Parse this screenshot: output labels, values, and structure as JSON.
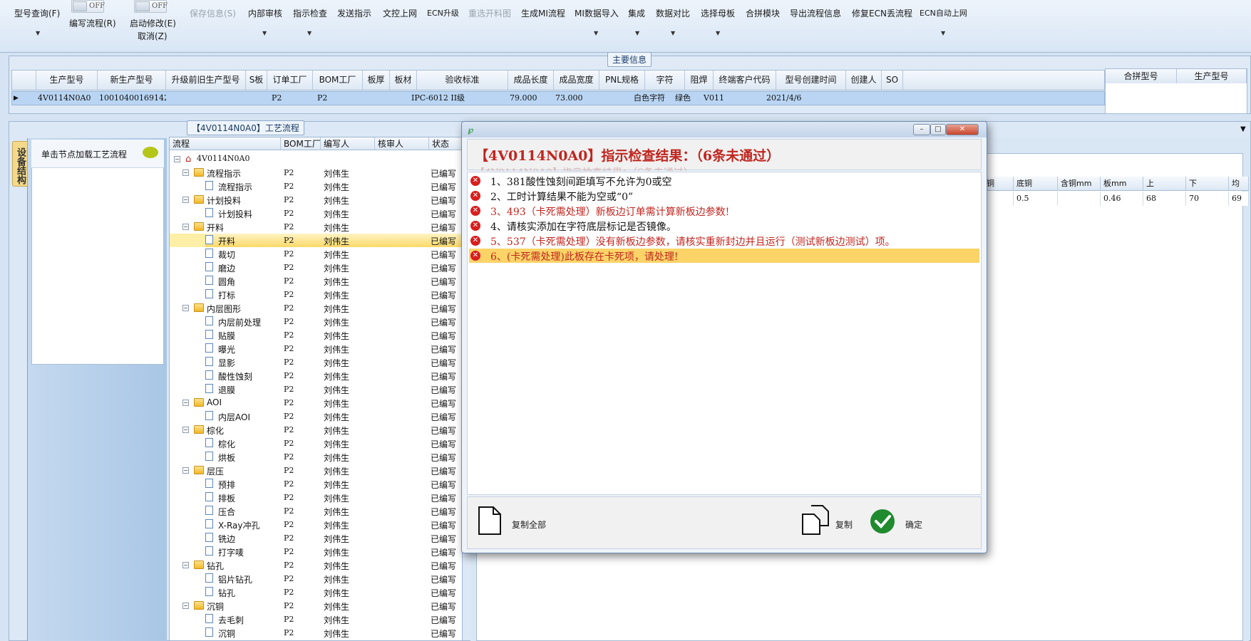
{
  "toolbar": {
    "items": [
      {
        "label": "型号查询(F)"
      },
      {
        "label": "编写流程(R)"
      },
      {
        "label": "启动修改(E)"
      },
      {
        "label": "取消(Z)"
      },
      {
        "label": "保存信息(S)"
      },
      {
        "label": "内部审核"
      },
      {
        "label": "指示检查"
      },
      {
        "label": "发送指示"
      },
      {
        "label": "文控上网"
      },
      {
        "label": "ECN升级"
      },
      {
        "label": "重选开料图"
      },
      {
        "label": "生成MI流程"
      },
      {
        "label": "MI数据导入"
      },
      {
        "label": "集成"
      },
      {
        "label": "数据对比"
      },
      {
        "label": "选择母板"
      },
      {
        "label": "合拼模块"
      },
      {
        "label": "导出流程信息"
      },
      {
        "label": "修复ECN丢流程"
      },
      {
        "label": "ECN自动上网"
      }
    ],
    "toggle1": "OFF",
    "toggle2": "OFF"
  },
  "main_info": {
    "title": "主要信息",
    "columns": [
      "生产型号",
      "新生产型号",
      "升级前旧生产型号",
      "S板",
      "订单工厂",
      "BOM工厂",
      "板厚",
      "板材",
      "验收标准",
      "成品长度",
      "成品宽度",
      "PNL规格",
      "字符",
      "阻焊",
      "终端客户代码",
      "型号创建时间",
      "创建人",
      "SO"
    ],
    "row": [
      "4V0114N0A0",
      "10010400169142",
      "",
      "",
      "P2",
      "P2",
      "",
      "",
      "IPC-6012 II级",
      "79.000",
      "73.000",
      "",
      "白色字符",
      "绿色",
      "V011",
      "2021/4/6",
      "",
      ""
    ],
    "right_columns": [
      "合拼型号",
      "生产型号"
    ]
  },
  "process": {
    "title": "【4V0114N0A0】工艺流程",
    "side_tab": "设备结构",
    "hint": "单击节点加载工艺流程",
    "columns": [
      "流程",
      "BOM工厂",
      "编写人",
      "核审人",
      "状态"
    ],
    "root": "4V0114N0A0",
    "rows": [
      {
        "name": "流程指示",
        "bom": "P2",
        "writer": "刘伟生",
        "status": "已编写"
      },
      {
        "name": "流程指示",
        "bom": "P2",
        "writer": "刘伟生",
        "status": "已编写"
      },
      {
        "name": "计划投料",
        "bom": "P2",
        "writer": "刘伟生",
        "status": "已编写"
      },
      {
        "name": "计划投料",
        "bom": "P2",
        "writer": "刘伟生",
        "status": "已编写"
      },
      {
        "name": "开料",
        "bom": "P2",
        "writer": "刘伟生",
        "status": "已编写"
      },
      {
        "name": "开料",
        "bom": "P2",
        "writer": "刘伟生",
        "status": "已编写"
      },
      {
        "name": "裁切",
        "bom": "P2",
        "writer": "刘伟生",
        "status": "已编写"
      },
      {
        "name": "磨边",
        "bom": "P2",
        "writer": "刘伟生",
        "status": "已编写"
      },
      {
        "name": "圆角",
        "bom": "P2",
        "writer": "刘伟生",
        "status": "已编写"
      },
      {
        "name": "打标",
        "bom": "P2",
        "writer": "刘伟生",
        "status": "已编写"
      },
      {
        "name": "内层图形",
        "bom": "P2",
        "writer": "刘伟生",
        "status": "已编写"
      },
      {
        "name": "内层前处理",
        "bom": "P2",
        "writer": "刘伟生",
        "status": "已编写"
      },
      {
        "name": "贴膜",
        "bom": "P2",
        "writer": "刘伟生",
        "status": "已编写"
      },
      {
        "name": "曝光",
        "bom": "P2",
        "writer": "刘伟生",
        "status": "已编写"
      },
      {
        "name": "显影",
        "bom": "P2",
        "writer": "刘伟生",
        "status": "已编写"
      },
      {
        "name": "酸性蚀刻",
        "bom": "P2",
        "writer": "刘伟生",
        "status": "已编写"
      },
      {
        "name": "退膜",
        "bom": "P2",
        "writer": "刘伟生",
        "status": "已编写"
      },
      {
        "name": "AOI",
        "bom": "P2",
        "writer": "刘伟生",
        "status": "已编写"
      },
      {
        "name": "内层AOI",
        "bom": "P2",
        "writer": "刘伟生",
        "status": "已编写"
      },
      {
        "name": "棕化",
        "bom": "P2",
        "writer": "刘伟生",
        "status": "已编写"
      },
      {
        "name": "棕化",
        "bom": "P2",
        "writer": "刘伟生",
        "status": "已编写"
      },
      {
        "name": "烘板",
        "bom": "P2",
        "writer": "刘伟生",
        "status": "已编写"
      },
      {
        "name": "层压",
        "bom": "P2",
        "writer": "刘伟生",
        "status": "已编写"
      },
      {
        "name": "预排",
        "bom": "P2",
        "writer": "刘伟生",
        "status": "已编写"
      },
      {
        "name": "排板",
        "bom": "P2",
        "writer": "刘伟生",
        "status": "已编写"
      },
      {
        "name": "压合",
        "bom": "P2",
        "writer": "刘伟生",
        "status": "已编写"
      },
      {
        "name": "X-Ray冲孔",
        "bom": "P2",
        "writer": "刘伟生",
        "status": "已编写"
      },
      {
        "name": "铣边",
        "bom": "P2",
        "writer": "刘伟生",
        "status": "已编写"
      },
      {
        "name": "打字唛",
        "bom": "P2",
        "writer": "刘伟生",
        "status": "已编写"
      },
      {
        "name": "钻孔",
        "bom": "P2",
        "writer": "刘伟生",
        "status": "已编写"
      },
      {
        "name": "铝片钻孔",
        "bom": "P2",
        "writer": "刘伟生",
        "status": "已编写"
      },
      {
        "name": "钻孔",
        "bom": "P2",
        "writer": "刘伟生",
        "status": "已编写"
      },
      {
        "name": "沉铜",
        "bom": "P2",
        "writer": "刘伟生",
        "status": "已编写"
      },
      {
        "name": "去毛刺",
        "bom": "P2",
        "writer": "刘伟生",
        "status": "已编写"
      },
      {
        "name": "沉铜",
        "bom": "P2",
        "writer": "刘伟生",
        "status": "已编写"
      }
    ]
  },
  "right_table": {
    "columns": [
      "铜",
      "底铜",
      "含铜mm",
      "板mm",
      "上",
      "下",
      "均"
    ],
    "row": [
      "",
      "0.5",
      "",
      "0.46",
      "68",
      "70",
      "69"
    ]
  },
  "dialog": {
    "title": "【4V0114N0A0】指示检查结果：（6条未通过）",
    "ghost": "【4V0114N0A0】指示检查结果：（6条未通过）",
    "items": [
      {
        "text": "1、381酸性蚀刻间距填写不允许为0或空",
        "color": "#111111"
      },
      {
        "text": "2、工时计算结果不能为空或“0”",
        "color": "#111111"
      },
      {
        "text": "3、493（卡死需处理）新板边订单需计算新板边参数!",
        "color": "#c0261f"
      },
      {
        "text": "4、请核实添加在字符底层标记是否镜像。",
        "color": "#111111"
      },
      {
        "text": "5、537（卡死需处理）没有新板边参数，请核实重新封边并且运行（测试新板边测试）项。",
        "color": "#c0261f"
      },
      {
        "text": "6、(卡死需处理)此板存在卡死项，请处理!",
        "color": "#c0261f"
      }
    ],
    "copy_all": "复制全部",
    "copy": "复制",
    "ok": "确定"
  }
}
